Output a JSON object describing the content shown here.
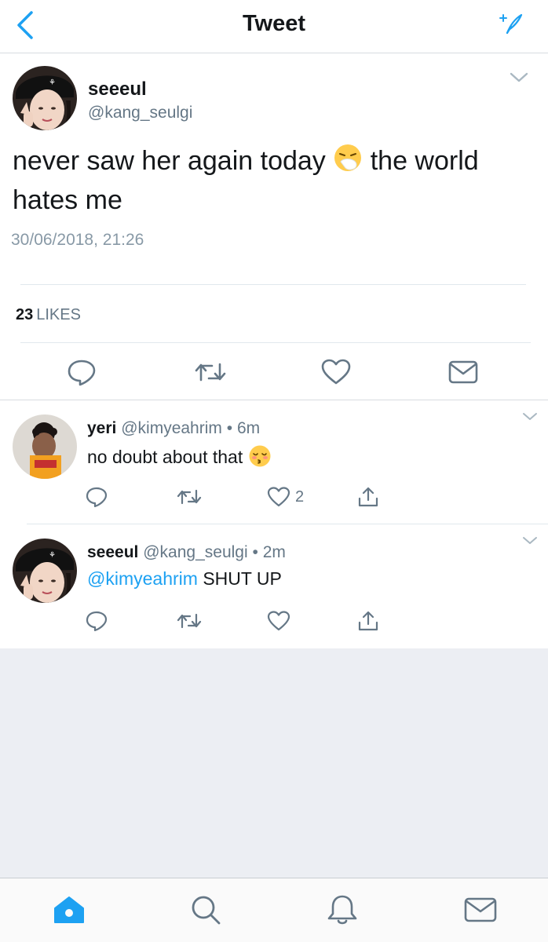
{
  "nav": {
    "title": "Tweet",
    "back_icon": "chevron-left-icon",
    "compose_icon": "sparkle-feather-icon",
    "accent": "#1da1f2"
  },
  "tweet": {
    "display_name": "seeeul",
    "handle": "@kang_seulgi",
    "text_part1": "never saw her again today",
    "emoji1": "sneezing-face-emoji",
    "text_part2": "the world hates me",
    "date": "30/06/2018, 21:26",
    "likes_count": "23",
    "likes_label": "LIKES"
  },
  "replies": [
    {
      "display_name": "yeri",
      "handle": "@kimyeahrim",
      "dot": "•",
      "time": "6m",
      "text": "no doubt about that",
      "emoji": "kissing-closed-eyes-emoji",
      "likes": "2"
    },
    {
      "display_name": "seeeul",
      "handle": "@kang_seulgi",
      "dot": "•",
      "time": "2m",
      "mention": "@kimyeahrim",
      "text": "SHUT UP"
    }
  ],
  "tabbar": {
    "tabs": [
      "home-icon",
      "search-icon",
      "notifications-bell-icon",
      "messages-envelope-icon"
    ],
    "active_color": "#1da1f2",
    "inactive_color": "#657786"
  }
}
